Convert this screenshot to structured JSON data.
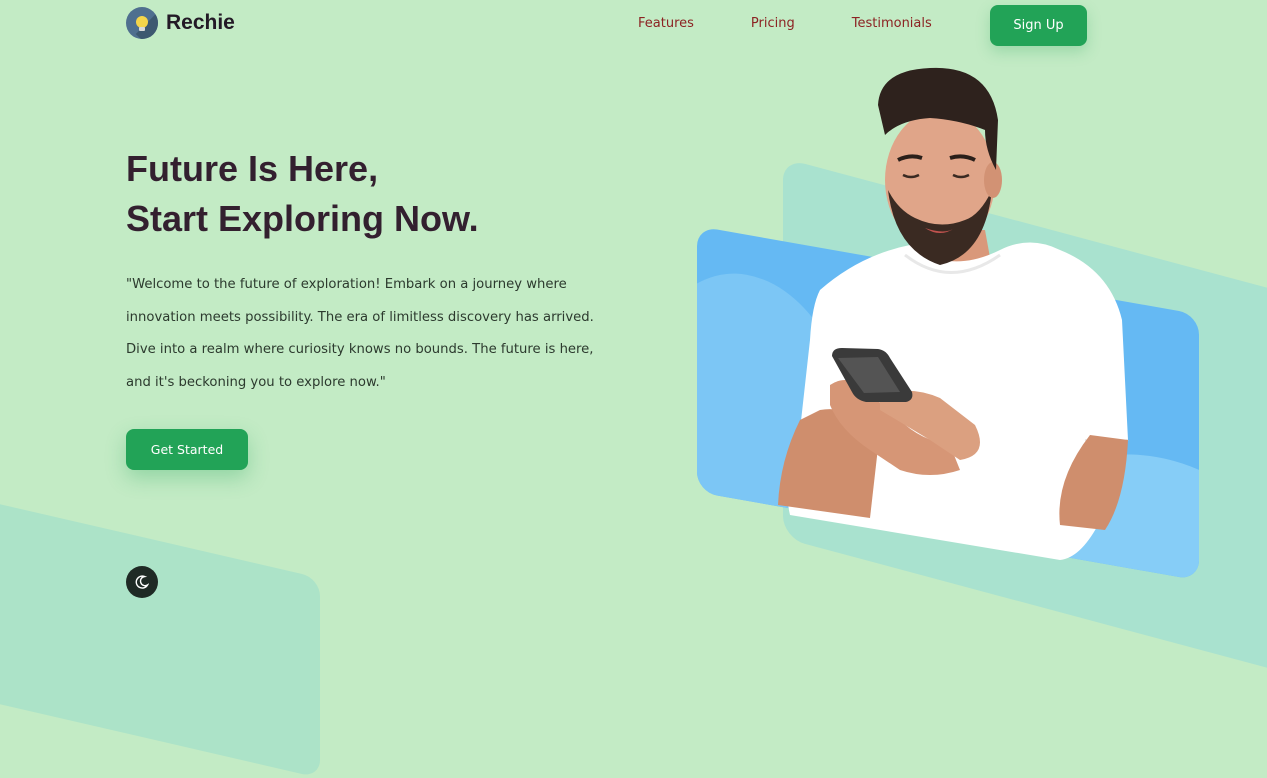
{
  "brand": {
    "name": "Rechie",
    "logo_icon": "lightbulb-icon"
  },
  "nav": {
    "items": [
      {
        "label": "Features"
      },
      {
        "label": "Pricing"
      },
      {
        "label": "Testimonials"
      }
    ],
    "signup_label": "Sign Up"
  },
  "hero": {
    "title_line1": "Future Is Here,",
    "title_line2": "Start Exploring Now.",
    "description": "\"Welcome to the future of exploration! Embark on a journey where innovation meets possibility. The era of limitless discovery has arrived. Dive into a realm where curiosity knows no bounds. The future is here, and it's beckoning you to explore now.\"",
    "cta_label": "Get Started"
  },
  "theme_toggle": {
    "icon": "moon-icon"
  },
  "colors": {
    "background": "#c3ebc5",
    "accent": "#22a357",
    "nav_link": "#8c2323",
    "heading": "#33202f",
    "card_blue": "#65b9f3"
  }
}
